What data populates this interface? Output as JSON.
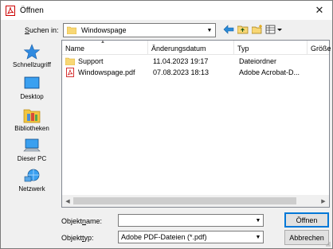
{
  "window": {
    "title": "Öffnen",
    "close_glyph": "✕"
  },
  "lookin": {
    "label_underlined": "S",
    "label_rest": "uchen in:",
    "value": "Windowspage"
  },
  "places": [
    {
      "label": "Schnellzugriff",
      "icon": "star-icon"
    },
    {
      "label": "Desktop",
      "icon": "desktop-icon"
    },
    {
      "label": "Bibliotheken",
      "icon": "libraries-icon"
    },
    {
      "label": "Dieser PC",
      "icon": "computer-icon"
    },
    {
      "label": "Netzwerk",
      "icon": "network-icon"
    }
  ],
  "columns": [
    "Name",
    "Änderungsdatum",
    "Typ",
    "Größe"
  ],
  "files": [
    {
      "name": "Support",
      "date": "11.04.2023 19:17",
      "type": "Dateiordner",
      "icon": "folder-icon"
    },
    {
      "name": "Windowspage.pdf",
      "date": "07.08.2023 18:13",
      "type": "Adobe Acrobat-D...",
      "icon": "pdf-icon"
    }
  ],
  "filename": {
    "label_pre": "Objekt",
    "label_underlined": "n",
    "label_post": "ame:",
    "value": ""
  },
  "filetype": {
    "label_pre": "Objekt",
    "label_underlined": "t",
    "label_post": "yp:",
    "value": "Adobe PDF-Dateien (*.pdf)"
  },
  "buttons": {
    "open": "Öffnen",
    "cancel": "Abbrechen"
  },
  "colors": {
    "accent": "#0078d7",
    "folder": "#f8d775"
  }
}
